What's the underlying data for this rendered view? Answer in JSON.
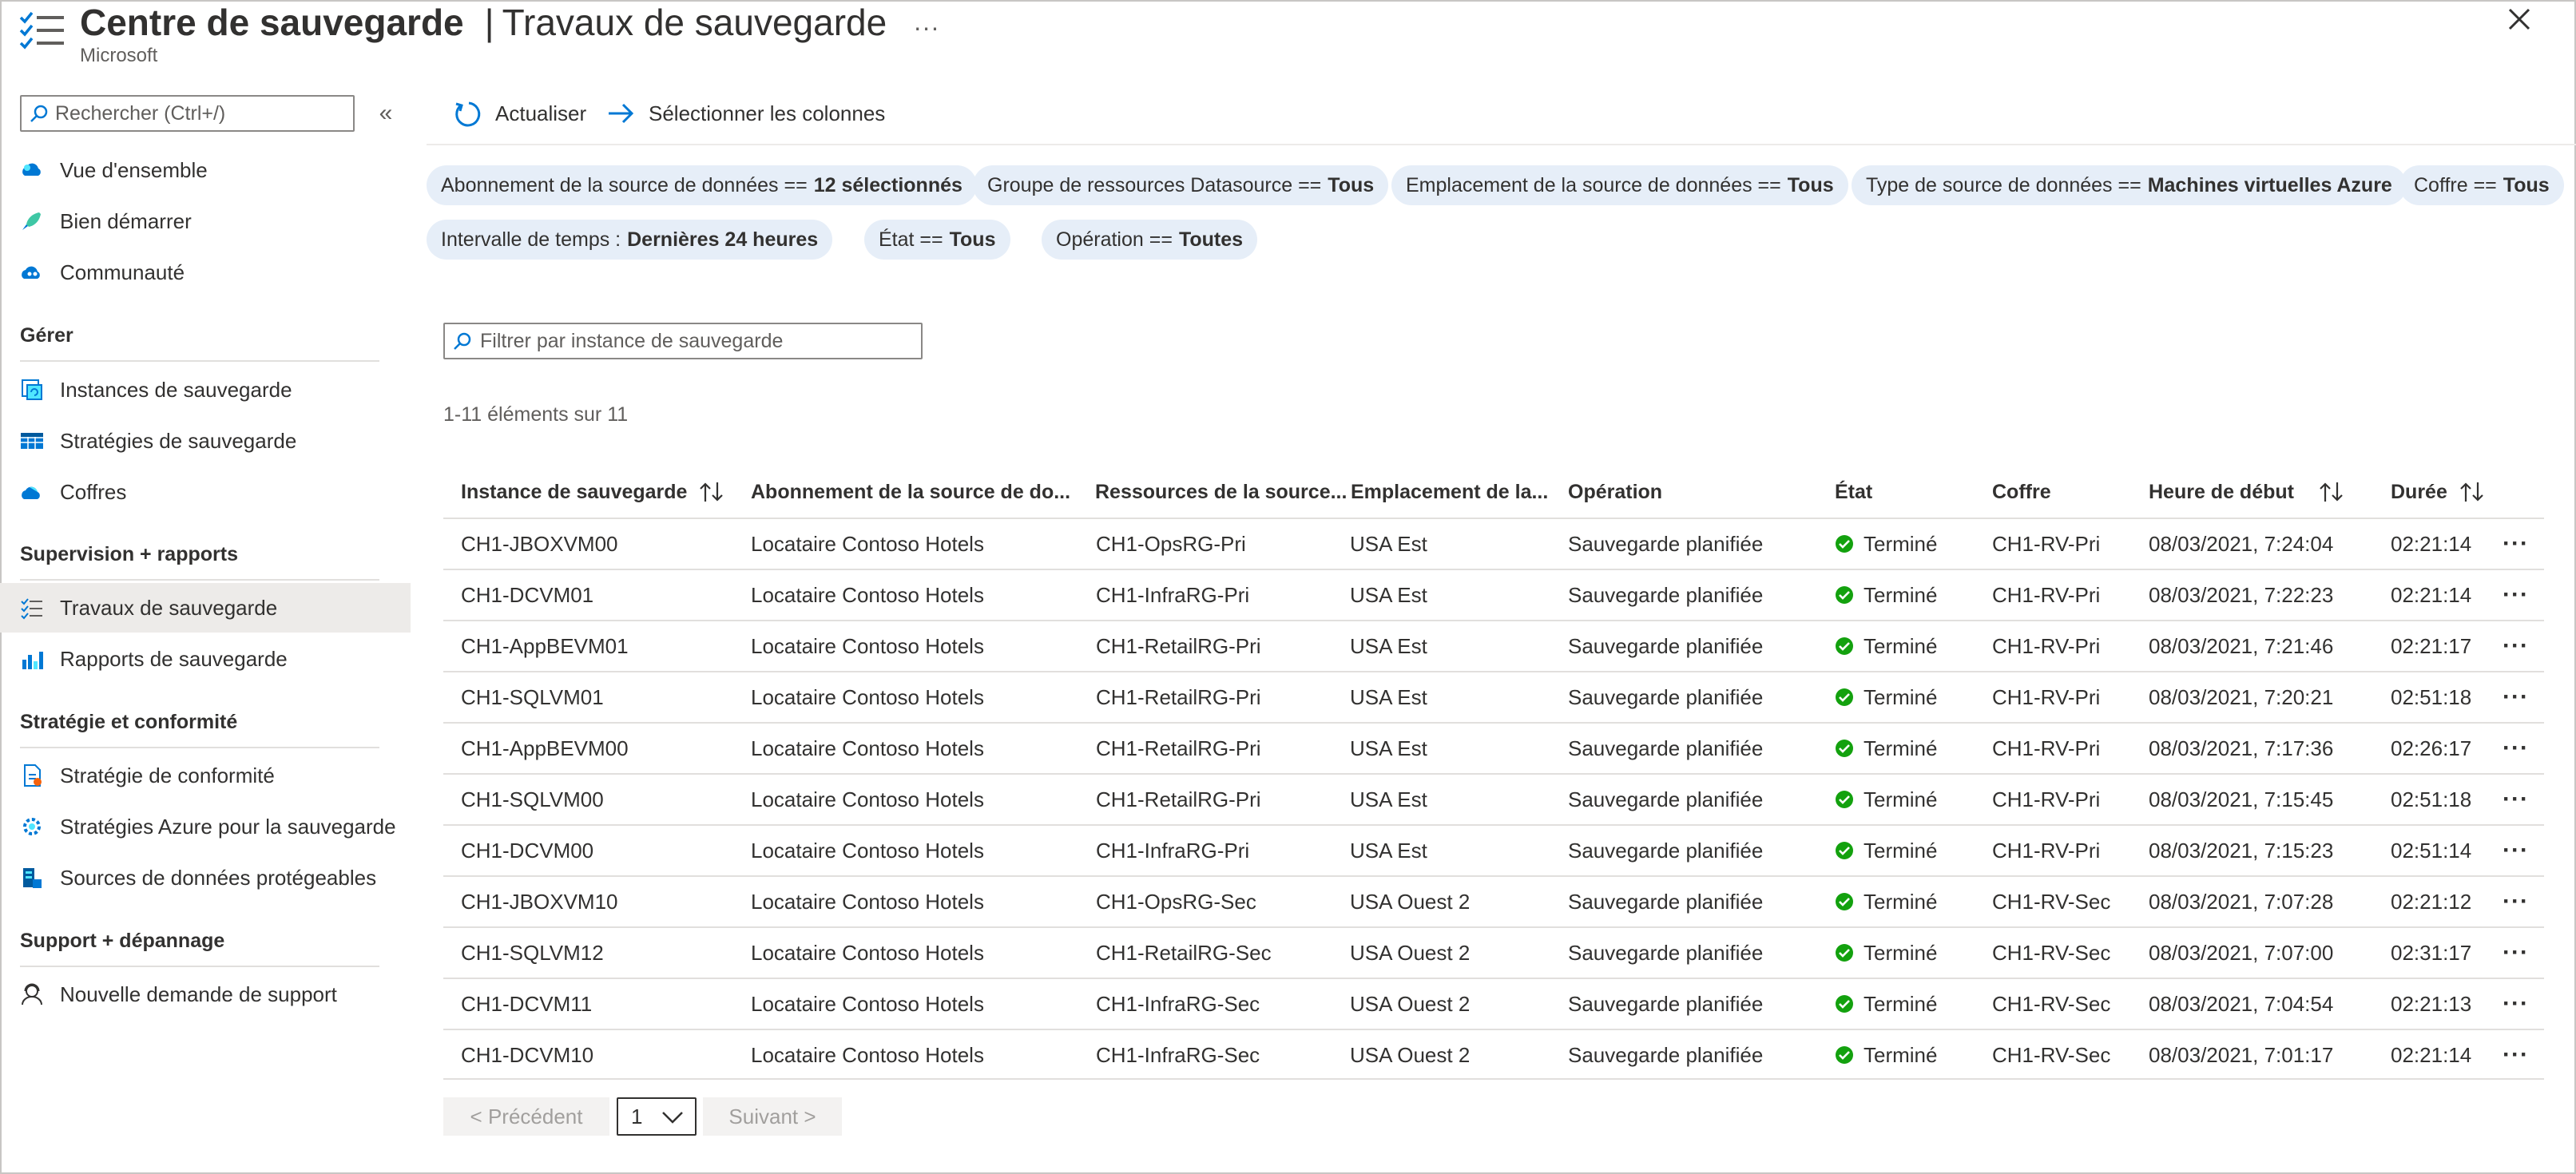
{
  "header": {
    "title": "Centre de sauvegarde",
    "separator": "|",
    "page": "Travaux de sauvegarde",
    "more": "...",
    "subtitle": "Microsoft"
  },
  "sidebar": {
    "search_placeholder": "Rechercher (Ctrl+/)",
    "collapse": "«",
    "top_items": [
      {
        "label": "Vue d'ensemble",
        "icon": "cloud-overview-icon"
      },
      {
        "label": "Bien démarrer",
        "icon": "rocket-icon"
      },
      {
        "label": "Communauté",
        "icon": "community-cloud-icon"
      }
    ],
    "sections": [
      {
        "title": "Gérer",
        "items": [
          {
            "label": "Instances de sauvegarde",
            "icon": "backup-instances-icon"
          },
          {
            "label": "Stratégies de sauvegarde",
            "icon": "table-policy-icon"
          },
          {
            "label": "Coffres",
            "icon": "vault-cloud-icon"
          }
        ]
      },
      {
        "title": "Supervision + rapports",
        "items": [
          {
            "label": "Travaux de sauvegarde",
            "icon": "jobs-list-icon",
            "active": true
          },
          {
            "label": "Rapports de sauvegarde",
            "icon": "bar-chart-icon"
          }
        ]
      },
      {
        "title": "Stratégie et conformité",
        "items": [
          {
            "label": "Stratégie de conformité",
            "icon": "compliance-doc-icon"
          },
          {
            "label": "Stratégies Azure pour la sauvegarde",
            "icon": "gear-policy-icon"
          },
          {
            "label": "Sources de données protégeables",
            "icon": "datasource-icon"
          }
        ]
      },
      {
        "title": "Support + dépannage",
        "items": [
          {
            "label": "Nouvelle demande de support",
            "icon": "support-person-icon"
          }
        ]
      }
    ]
  },
  "toolbar": {
    "refresh": "Actualiser",
    "columns": "Sélectionner les colonnes"
  },
  "filters": {
    "row1": [
      {
        "label": "Abonnement de la source de données ==",
        "value": "12 sélectionnés"
      },
      {
        "label": "Groupe de ressources Datasource ==",
        "value": "Tous"
      },
      {
        "label": "Emplacement de la source de données ==",
        "value": "Tous"
      },
      {
        "label": "Type de source de données ==",
        "value": "Machines virtuelles Azure"
      },
      {
        "label": "Coffre ==",
        "value": "Tous"
      }
    ],
    "row2": [
      {
        "label": "Intervalle de temps :",
        "value": "Dernières 24 heures"
      },
      {
        "label": "État ==",
        "value": "Tous"
      },
      {
        "label": "Opération ==",
        "value": "Toutes"
      }
    ]
  },
  "filter_box_placeholder": "Filtrer par instance de sauvegarde",
  "count_text": "1-11 éléments sur 11",
  "table": {
    "columns": [
      "Instance de sauvegarde",
      "Abonnement de la source de do...",
      "Ressources de la source...",
      "Emplacement de la...",
      "Opération",
      "État",
      "Coffre",
      "Heure de début",
      "Durée"
    ],
    "rows": [
      [
        "CH1-JBOXVM00",
        "Locataire Contoso Hotels",
        "CH1-OpsRG-Pri",
        "USA Est",
        "Sauvegarde planifiée",
        "Terminé",
        "CH1-RV-Pri",
        "08/03/2021, 7:24:04",
        "02:21:14"
      ],
      [
        "CH1-DCVM01",
        "Locataire Contoso Hotels",
        "CH1-InfraRG-Pri",
        "USA Est",
        "Sauvegarde planifiée",
        "Terminé",
        "CH1-RV-Pri",
        "08/03/2021, 7:22:23",
        "02:21:14"
      ],
      [
        "CH1-AppBEVM01",
        "Locataire Contoso Hotels",
        "CH1-RetailRG-Pri",
        "USA Est",
        "Sauvegarde planifiée",
        "Terminé",
        "CH1-RV-Pri",
        "08/03/2021, 7:21:46",
        "02:21:17"
      ],
      [
        "CH1-SQLVM01",
        "Locataire Contoso Hotels",
        "CH1-RetailRG-Pri",
        "USA Est",
        "Sauvegarde planifiée",
        "Terminé",
        "CH1-RV-Pri",
        "08/03/2021, 7:20:21",
        "02:51:18"
      ],
      [
        "CH1-AppBEVM00",
        "Locataire Contoso Hotels",
        "CH1-RetailRG-Pri",
        "USA Est",
        "Sauvegarde planifiée",
        "Terminé",
        "CH1-RV-Pri",
        "08/03/2021, 7:17:36",
        "02:26:17"
      ],
      [
        "CH1-SQLVM00",
        "Locataire Contoso Hotels",
        "CH1-RetailRG-Pri",
        "USA Est",
        "Sauvegarde planifiée",
        "Terminé",
        "CH1-RV-Pri",
        "08/03/2021, 7:15:45",
        "02:51:18"
      ],
      [
        "CH1-DCVM00",
        "Locataire Contoso Hotels",
        "CH1-InfraRG-Pri",
        "USA Est",
        "Sauvegarde planifiée",
        "Terminé",
        "CH1-RV-Pri",
        "08/03/2021, 7:15:23",
        "02:51:14"
      ],
      [
        "CH1-JBOXVM10",
        "Locataire Contoso Hotels",
        "CH1-OpsRG-Sec",
        "USA Ouest 2",
        "Sauvegarde planifiée",
        "Terminé",
        "CH1-RV-Sec",
        "08/03/2021, 7:07:28",
        "02:21:12"
      ],
      [
        "CH1-SQLVM12",
        "Locataire Contoso Hotels",
        "CH1-RetailRG-Sec",
        "USA Ouest 2",
        "Sauvegarde planifiée",
        "Terminé",
        "CH1-RV-Sec",
        "08/03/2021, 7:07:00",
        "02:31:17"
      ],
      [
        "CH1-DCVM11",
        "Locataire Contoso Hotels",
        "CH1-InfraRG-Sec",
        "USA Ouest 2",
        "Sauvegarde planifiée",
        "Terminé",
        "CH1-RV-Sec",
        "08/03/2021, 7:04:54",
        "02:21:13"
      ],
      [
        "CH1-DCVM10",
        "Locataire Contoso Hotels",
        "CH1-InfraRG-Sec",
        "USA Ouest 2",
        "Sauvegarde planifiée",
        "Terminé",
        "CH1-RV-Sec",
        "08/03/2021, 7:01:17",
        "02:21:14"
      ]
    ],
    "row_more": "···"
  },
  "pager": {
    "prev": "< Précédent",
    "page": "1",
    "next": "Suivant >"
  },
  "colors": {
    "accent": "#0078d4",
    "pill_bg": "#e6eef8",
    "success": "#13a10e",
    "active_nav": "#edebe9"
  }
}
